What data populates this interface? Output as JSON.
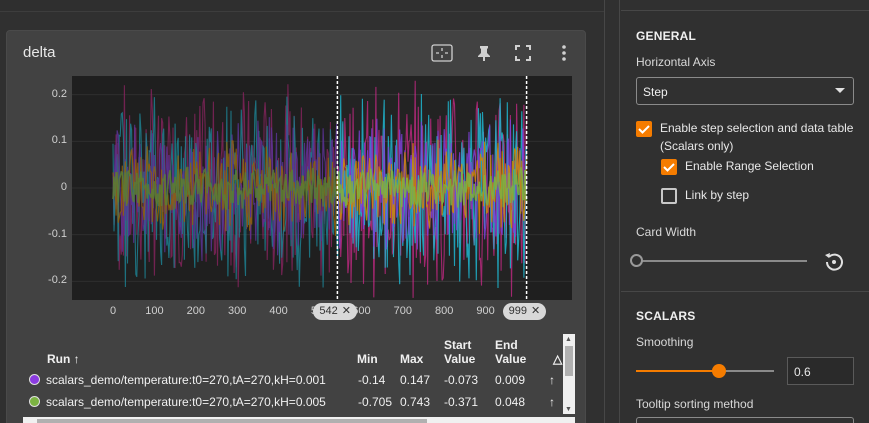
{
  "card": {
    "title": "delta",
    "icons": [
      "fit-domain-icon",
      "pin-icon",
      "fullscreen-icon",
      "more-vert-icon"
    ]
  },
  "chart_data": {
    "type": "line",
    "title": "delta",
    "xlim": [
      0,
      1000
    ],
    "ylim": [
      -0.24,
      0.24
    ],
    "x_ticks": [
      "0",
      "100",
      "200",
      "300",
      "400",
      "500",
      "600",
      "700",
      "800",
      "900"
    ],
    "y_ticks": [
      "0.2",
      "0.1",
      "0",
      "-0.1",
      "-0.2"
    ],
    "range_selection": [
      542,
      999
    ],
    "series": [
      {
        "color": "#7e3fd8"
      },
      {
        "color": "#7cb342"
      },
      {
        "color": "#d08a00"
      },
      {
        "color": "#1eb6d0"
      },
      {
        "color": "#cc2a8a"
      }
    ]
  },
  "range": {
    "start_label": "542",
    "end_label": "999"
  },
  "table": {
    "headers": {
      "run": "Run",
      "min": "Min",
      "max": "Max",
      "start": "Start Value",
      "end": "End Value"
    },
    "rows": [
      {
        "color": "#8b3be0",
        "run": "scalars_demo/temperature:t0=270,tA=270,kH=0.001",
        "min": "-0.14",
        "max": "0.147",
        "start": "-0.073",
        "end": "0.009"
      },
      {
        "color": "#7cb342",
        "run": "scalars_demo/temperature:t0=270,tA=270,kH=0.005",
        "min": "-0.705",
        "max": "0.743",
        "start": "-0.371",
        "end": "0.048"
      }
    ]
  },
  "settings": {
    "general_heading": "GENERAL",
    "horizontal_axis_label": "Horizontal Axis",
    "horizontal_axis_value": "Step",
    "step_selection_label": "Enable step selection and data table",
    "step_selection_sub": "(Scalars only)",
    "range_selection_label": "Enable Range Selection",
    "link_by_step_label": "Link by step",
    "card_width_label": "Card Width",
    "scalars_heading": "SCALARS",
    "smoothing_label": "Smoothing",
    "smoothing_value": "0.6",
    "smoothing_fraction": 0.6,
    "tooltip_sort_label": "Tooltip sorting method"
  }
}
